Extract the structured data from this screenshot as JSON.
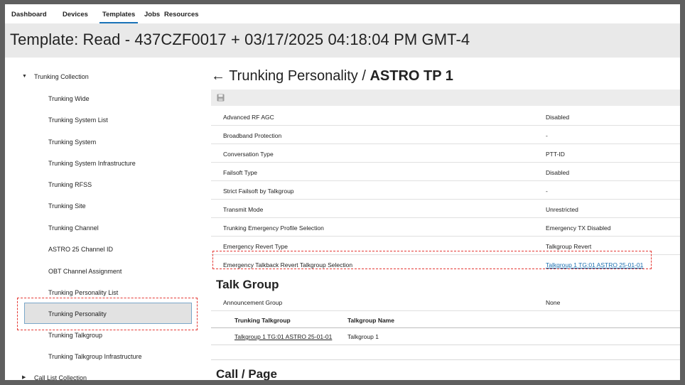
{
  "nav": {
    "items": [
      "Dashboard",
      "Devices",
      "Templates",
      "Jobs",
      "Resources"
    ],
    "active": "Templates"
  },
  "page_title": "Template: Read - 437CZF0017 + 03/17/2025 04:18:04 PM GMT-4",
  "tree": {
    "items": [
      {
        "label": "Trunking Collection",
        "caret": "▼"
      },
      {
        "label": "Trunking Wide"
      },
      {
        "label": "Trunking System List"
      },
      {
        "label": "Trunking System"
      },
      {
        "label": "Trunking System Infrastructure"
      },
      {
        "label": "Trunking RFSS"
      },
      {
        "label": "Trunking Site"
      },
      {
        "label": "Trunking Channel"
      },
      {
        "label": "ASTRO 25 Channel ID"
      },
      {
        "label": "OBT Channel Assignment"
      },
      {
        "label": "Trunking Personality List"
      },
      {
        "label": "Trunking Personality",
        "selected": true
      },
      {
        "label": "Trunking Talkgroup"
      },
      {
        "label": "Trunking Talkgroup Infrastructure"
      },
      {
        "label": "Call List Collection",
        "caret": "▶"
      }
    ]
  },
  "panel": {
    "back_arrow": "←",
    "breadcrumb_parent": "Trunking Personality",
    "breadcrumb_sep": " / ",
    "breadcrumb_current": "ASTRO TP 1",
    "properties": [
      {
        "key": "Advanced RF AGC",
        "value": "Disabled"
      },
      {
        "key": "Broadband Protection",
        "value": "-"
      },
      {
        "key": "Conversation Type",
        "value": "PTT-ID"
      },
      {
        "key": "Failsoft Type",
        "value": "Disabled"
      },
      {
        "key": "Strict Failsoft by Talkgroup",
        "value": "-"
      },
      {
        "key": "Transmit Mode",
        "value": "Unrestricted"
      },
      {
        "key": "Trunking Emergency Profile Selection",
        "value": "Emergency TX Disabled"
      },
      {
        "key": "Emergency Revert Type",
        "value": "Talkgroup Revert"
      },
      {
        "key": "Emergency Talkback Revert Talkgroup Selection",
        "value": "Talkgroup 1 TG:01 ASTRO 25-01-01",
        "link": true
      }
    ],
    "talk_group": {
      "heading": "Talk Group",
      "announcement_key": "Announcement Group",
      "announcement_value": "None",
      "columns": [
        "Trunking Talkgroup",
        "Talkgroup Name"
      ],
      "rows": [
        {
          "talkgroup": "Talkgroup 1 TG:01 ASTRO 25-01-01",
          "name": "Talkgroup 1"
        }
      ]
    },
    "call_page_heading": "Call / Page"
  },
  "colors": {
    "accent": "#1a73b8",
    "link": "#1a6fb0",
    "highlight_dash": "#e53935",
    "title_bg": "#e9e9e9"
  }
}
